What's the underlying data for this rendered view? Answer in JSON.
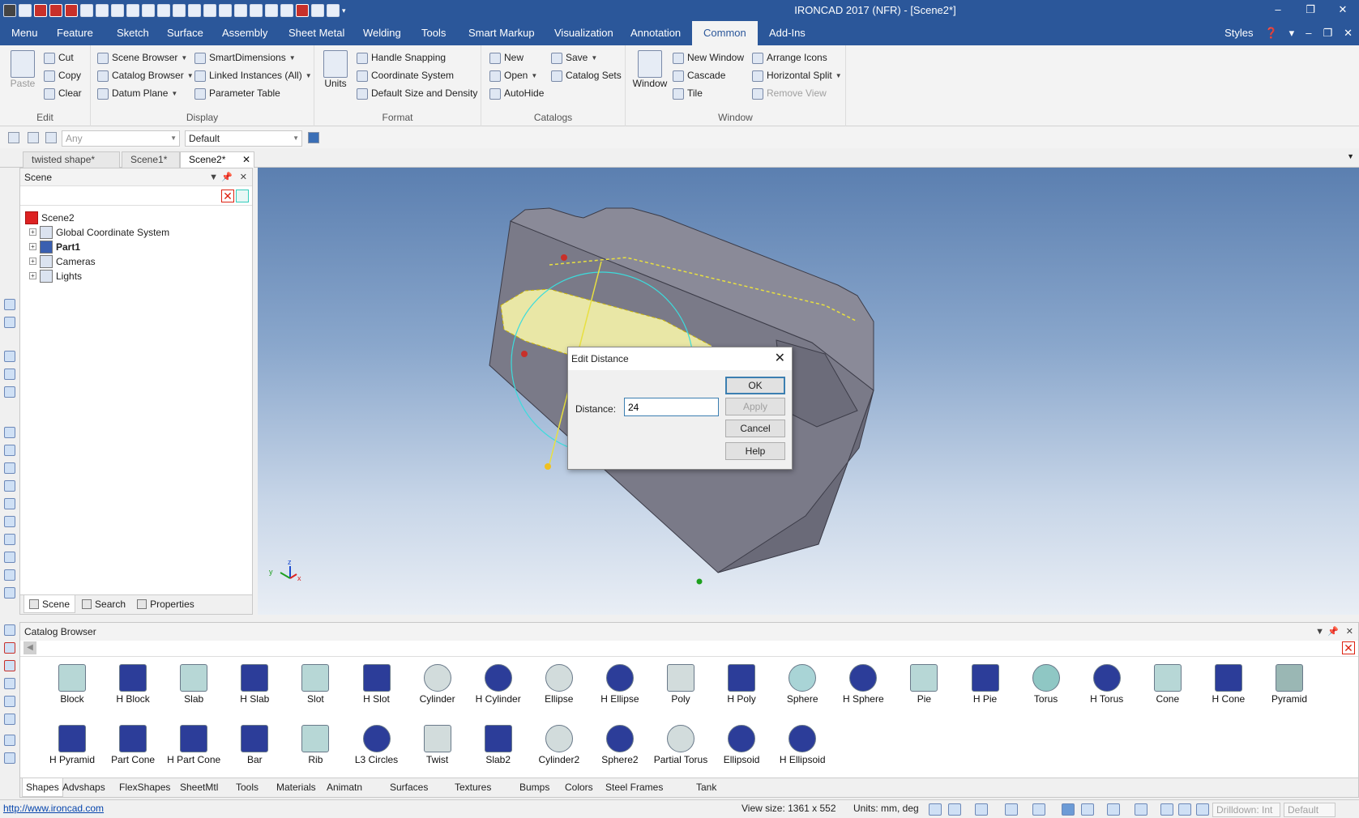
{
  "app": {
    "title": "IRONCAD 2017 (NFR) - [Scene2*]"
  },
  "ribbon": {
    "tabs": [
      "Menu",
      "Feature",
      "Sketch",
      "Surface",
      "Assembly",
      "Sheet Metal",
      "Welding",
      "Tools",
      "Smart Markup",
      "Visualization",
      "Annotation",
      "Common",
      "Add-Ins"
    ],
    "active_tab": "Common",
    "right": {
      "styles": "Styles"
    },
    "edit": {
      "label": "Edit",
      "paste": "Paste",
      "cut": "Cut",
      "copy": "Copy",
      "clear": "Clear"
    },
    "display": {
      "label": "Display",
      "scene_browser": "Scene Browser",
      "catalog_browser": "Catalog Browser",
      "datum_plane": "Datum Plane",
      "smart_dimensions": "SmartDimensions",
      "linked_instances": "Linked Instances (All)",
      "parameter_table": "Parameter Table"
    },
    "format": {
      "label": "Format",
      "units": "Units",
      "handle_snapping": "Handle Snapping",
      "coordinate_system": "Coordinate System",
      "default_size": "Default Size and Density"
    },
    "catalogs": {
      "label": "Catalogs",
      "new": "New",
      "open": "Open",
      "autohide": "AutoHide",
      "save": "Save",
      "catalog_sets": "Catalog Sets"
    },
    "window": {
      "label": "Window",
      "window": "Window",
      "new_window": "New Window",
      "cascade": "Cascade",
      "tile": "Tile",
      "arrange_icons": "Arrange Icons",
      "horizontal_split": "Horizontal Split",
      "remove_view": "Remove View"
    }
  },
  "toolbar": {
    "filter_value": "Any",
    "style_value": "Default"
  },
  "doc_tabs": [
    "twisted shape*",
    "Scene1*",
    "Scene2*"
  ],
  "scene_panel": {
    "title": "Scene",
    "tree": [
      {
        "label": "Scene2",
        "bold": false,
        "expandable": false
      },
      {
        "label": "Global Coordinate System",
        "bold": false,
        "expandable": true
      },
      {
        "label": "Part1",
        "bold": true,
        "expandable": true
      },
      {
        "label": "Cameras",
        "bold": false,
        "expandable": true
      },
      {
        "label": "Lights",
        "bold": false,
        "expandable": true
      }
    ],
    "tabs": [
      "Scene",
      "Search",
      "Properties"
    ]
  },
  "dialog": {
    "title": "Edit Distance",
    "label": "Distance:",
    "value": "24",
    "ok": "OK",
    "apply": "Apply",
    "cancel": "Cancel",
    "help": "Help"
  },
  "catalog": {
    "title": "Catalog Browser",
    "shapes": [
      "Block",
      "H Block",
      "Slab",
      "H Slab",
      "Slot",
      "H Slot",
      "Cylinder",
      "H Cylinder",
      "Ellipse",
      "H Ellipse",
      "Poly",
      "H Poly",
      "Sphere",
      "H Sphere",
      "Pie",
      "H Pie",
      "Torus",
      "H Torus",
      "Cone",
      "H Cone",
      "Pyramid",
      "H Pyramid",
      "Part Cone",
      "H Part Cone",
      "Bar",
      "Rib",
      "L3 Circles",
      "Twist",
      "Slab2",
      "Cylinder2",
      "Sphere2",
      "Partial Torus",
      "Ellipsoid",
      "H Ellipsoid"
    ],
    "tabs": [
      "Shapes",
      "Advshaps",
      "FlexShapes",
      "SheetMtl",
      "Tools",
      "Materials",
      "Animatn",
      "Surfaces",
      "Textures",
      "Bumps",
      "Colors",
      "Steel Frames",
      "Tank"
    ]
  },
  "status": {
    "url": "http://www.ironcad.com",
    "view_size": "View size: 1361 x  552",
    "units": "Units: mm, deg",
    "drilldown": "Drilldown: Int",
    "default": "Default"
  },
  "colors": {
    "accent": "#2b579a",
    "part_face": "#7e7e8c",
    "highlight": "#e9e7a6",
    "selection": "#3cdcdc"
  }
}
